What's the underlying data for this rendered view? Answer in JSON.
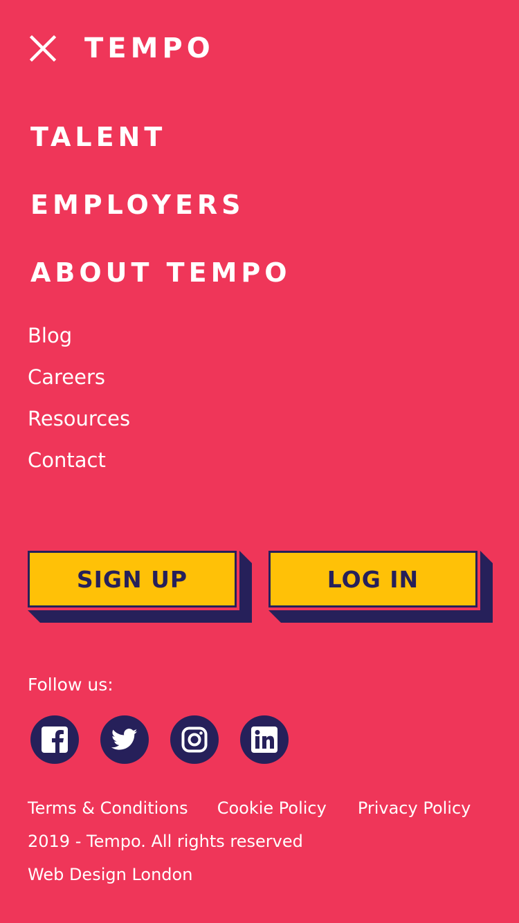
{
  "header": {
    "logo": "TEMPO",
    "close_icon": "close-icon"
  },
  "main_nav": {
    "items": [
      {
        "label": "TALENT"
      },
      {
        "label": "EMPLOYERS"
      },
      {
        "label": "ABOUT TEMPO"
      }
    ]
  },
  "sub_nav": {
    "items": [
      {
        "label": "Blog"
      },
      {
        "label": "Careers"
      },
      {
        "label": "Resources"
      },
      {
        "label": "Contact"
      }
    ]
  },
  "actions": {
    "signup_label": "SIGN UP",
    "login_label": "LOG IN"
  },
  "social": {
    "label": "Follow us:",
    "icons": [
      "facebook-icon",
      "twitter-icon",
      "instagram-icon",
      "linkedin-icon"
    ]
  },
  "footer": {
    "links": [
      {
        "label": "Terms & Conditions"
      },
      {
        "label": "Cookie Policy"
      },
      {
        "label": "Privacy Policy"
      }
    ],
    "copyright": "2019 - Tempo. All rights reserved",
    "credit": "Web Design London"
  },
  "colors": {
    "background": "#EF3659",
    "button": "#FFC107",
    "navy": "#26205A",
    "text": "#FFFFFF"
  }
}
